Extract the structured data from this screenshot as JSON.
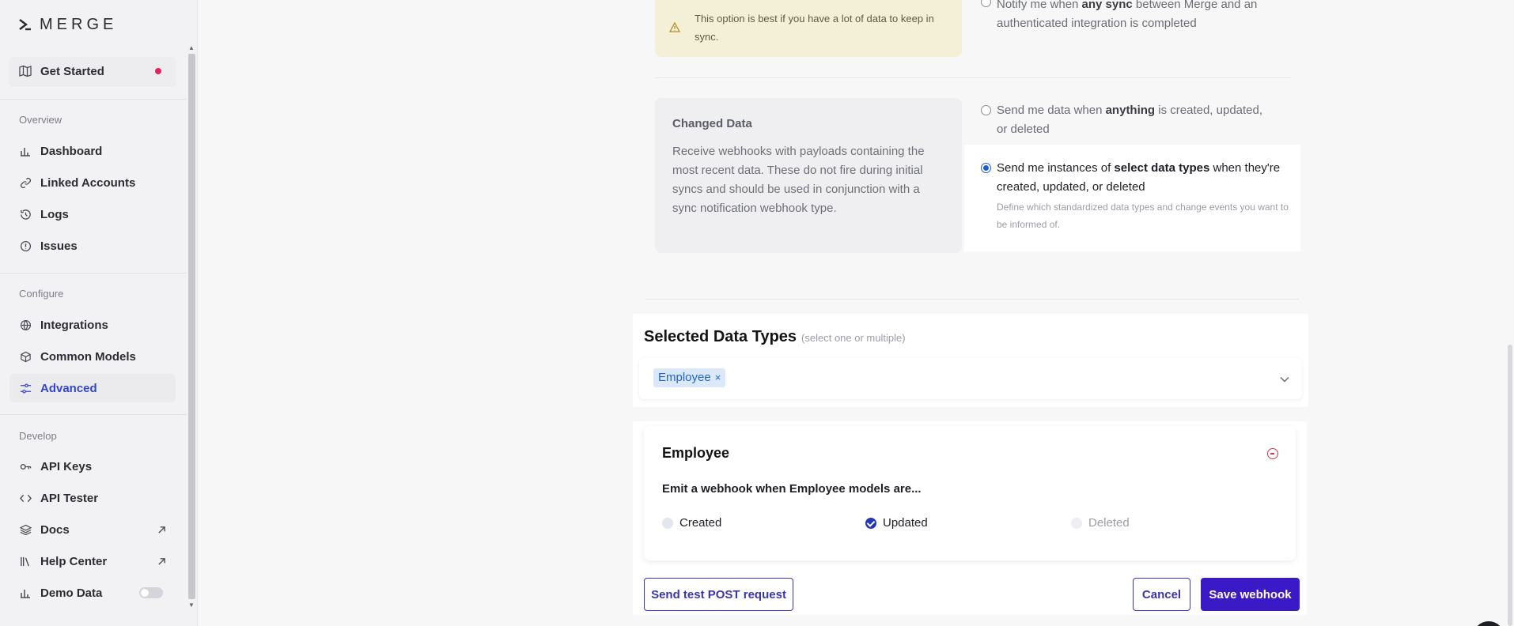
{
  "brand": {
    "logo_text": "MERGE"
  },
  "sidebar": {
    "get_started": "Get Started",
    "sections": {
      "overview": "Overview",
      "configure": "Configure",
      "develop": "Develop"
    },
    "overview_items": [
      {
        "label": "Dashboard",
        "icon": "bar-chart-icon"
      },
      {
        "label": "Linked Accounts",
        "icon": "link-icon"
      },
      {
        "label": "Logs",
        "icon": "logs-icon"
      },
      {
        "label": "Issues",
        "icon": "alert-circle-icon"
      }
    ],
    "configure_items": [
      {
        "label": "Integrations",
        "icon": "globe-icon"
      },
      {
        "label": "Common Models",
        "icon": "cube-icon"
      },
      {
        "label": "Advanced",
        "icon": "sliders-icon",
        "active": true
      }
    ],
    "develop_items": [
      {
        "label": "API Keys",
        "icon": "key-icon"
      },
      {
        "label": "API Tester",
        "icon": "code-icon"
      },
      {
        "label": "Docs",
        "icon": "layers-icon",
        "external": true
      },
      {
        "label": "Help Center",
        "icon": "library-icon",
        "external": true
      },
      {
        "label": "Demo Data",
        "icon": "bar-chart-icon",
        "toggle": false
      }
    ]
  },
  "webhook": {
    "warning_text": "This option is best if you have a lot of data to keep in sync.",
    "any_sync_option": {
      "prefix": "Notify me when ",
      "bold": "any sync",
      "suffix": " between Merge and an authenticated integration is completed"
    },
    "changed_data": {
      "title": "Changed Data",
      "description": "Receive webhooks with payloads containing the most recent data. These do not fire during initial syncs and should be used in conjunction with a sync notification webhook type."
    },
    "anything_option": {
      "prefix": "Send me data when ",
      "bold": "anything",
      "suffix": " is created, updated, or deleted"
    },
    "select_option": {
      "prefix": "Send me instances of ",
      "bold": "select data types",
      "suffix": " when they're created, updated, or deleted",
      "hint": "Define which standardized data types and change events you want to be informed of."
    },
    "selected_data_types": {
      "title": "Selected Data Types",
      "subtitle": "(select one or multiple)",
      "chips": [
        "Employee"
      ]
    },
    "employee_card": {
      "title": "Employee",
      "emit_text": "Emit a webhook when Employee models are...",
      "options": [
        {
          "label": "Created",
          "checked": false,
          "disabled": false
        },
        {
          "label": "Updated",
          "checked": true,
          "disabled": false
        },
        {
          "label": "Deleted",
          "checked": false,
          "disabled": true
        }
      ]
    },
    "buttons": {
      "send_test": "Send test POST request",
      "cancel": "Cancel",
      "save": "Save webhook"
    }
  },
  "colors": {
    "accent": "#3a19c7",
    "active_nav": "#3346c9",
    "danger": "#d9314b",
    "chip_bg": "#dbe8fa"
  }
}
